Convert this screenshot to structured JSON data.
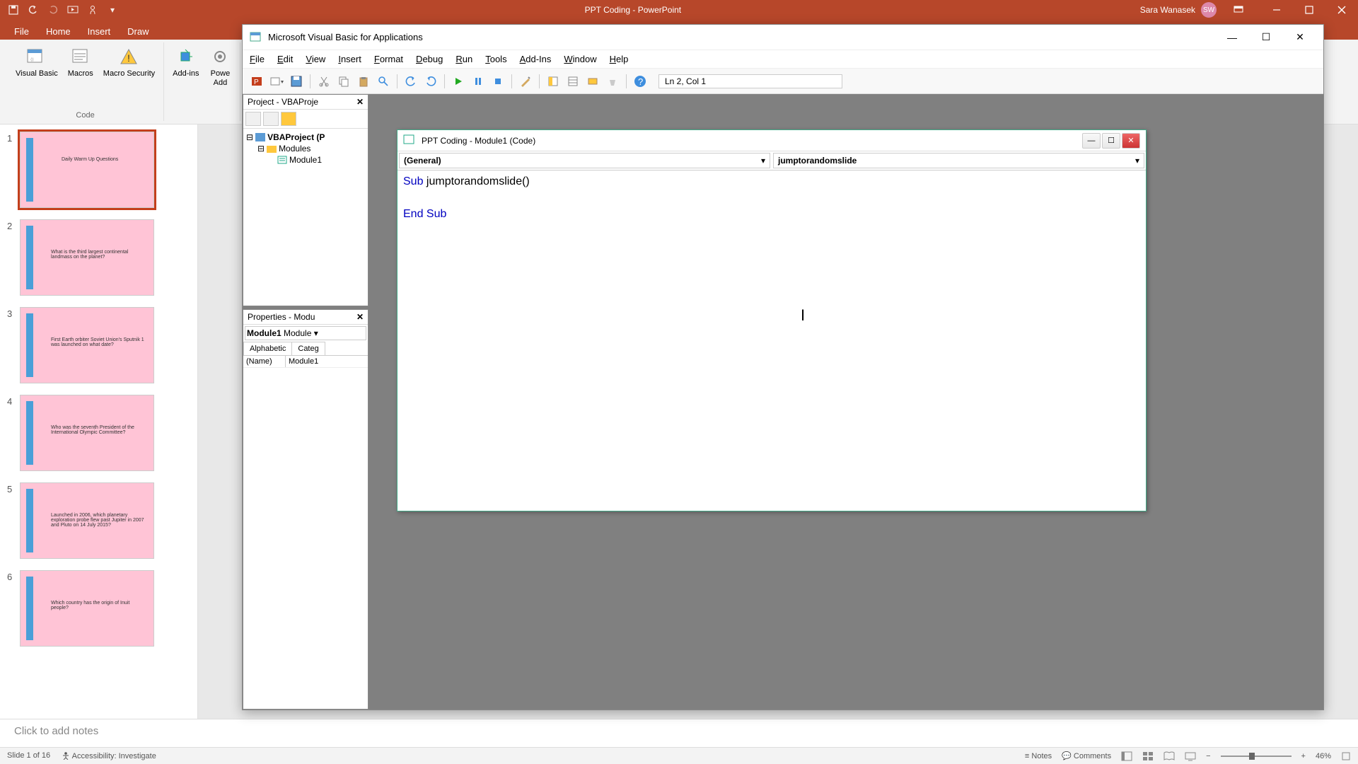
{
  "pp": {
    "title": "PPT Coding  -  PowerPoint",
    "user": "Sara Wanasek",
    "initials": "SW",
    "tabs": [
      "File",
      "Home",
      "Insert",
      "Draw"
    ],
    "ribbon": {
      "visual_basic": "Visual Basic",
      "macros": "Macros",
      "macro_security": "Macro Security",
      "addins": "Add-ins",
      "powr": "Powe",
      "add": "Add",
      "code_group": "Code"
    },
    "notes_placeholder": "Click to add notes",
    "status": {
      "slide": "Slide 1 of 16",
      "accessibility": "Accessibility: Investigate",
      "notes": "Notes",
      "comments": "Comments",
      "zoom": "46%"
    },
    "slides": [
      {
        "n": "1",
        "text": "Daily Warm Up Questions"
      },
      {
        "n": "2",
        "text": "What is the third largest continental landmass on the planet?"
      },
      {
        "n": "3",
        "text": "First Earth orbiter Soviet Union's Sputnik 1 was launched on what date?"
      },
      {
        "n": "4",
        "text": "Who was the seventh President of the International Olympic Committee?"
      },
      {
        "n": "5",
        "text": "Launched in 2006, which planetary exploration probe flew past Jupiter in 2007 and Pluto on 14 July 2015?"
      },
      {
        "n": "6",
        "text": "Which country has the origin of Inuit people?"
      }
    ]
  },
  "vba": {
    "title": "Microsoft Visual Basic for Applications",
    "menus": [
      "File",
      "Edit",
      "View",
      "Insert",
      "Format",
      "Debug",
      "Run",
      "Tools",
      "Add-Ins",
      "Window",
      "Help"
    ],
    "cursor_status": "Ln 2, Col 1",
    "project_title": "Project - VBAProje",
    "project_root": "VBAProject (P",
    "modules_folder": "Modules",
    "module_name": "Module1",
    "props_title": "Properties - Modu",
    "props_combo": "Module1 Module",
    "props_tab1": "Alphabetic",
    "props_tab2": "Categ",
    "prop_name_label": "(Name)",
    "prop_name_val": "Module1",
    "code": {
      "title": "PPT Coding - Module1 (Code)",
      "dd1": "(General)",
      "dd2": "jumptorandomslide",
      "line1_kw": "Sub ",
      "line1_rest": "jumptorandomslide()",
      "line3": "End Sub"
    }
  }
}
